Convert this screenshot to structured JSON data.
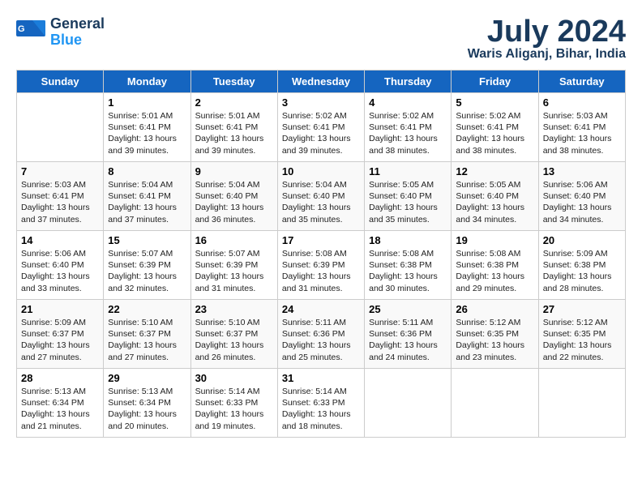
{
  "header": {
    "logo_line1": "General",
    "logo_line2": "Blue",
    "month": "July 2024",
    "location": "Waris Aliganj, Bihar, India"
  },
  "days_of_week": [
    "Sunday",
    "Monday",
    "Tuesday",
    "Wednesday",
    "Thursday",
    "Friday",
    "Saturday"
  ],
  "weeks": [
    [
      {
        "num": "",
        "info": ""
      },
      {
        "num": "1",
        "info": "Sunrise: 5:01 AM\nSunset: 6:41 PM\nDaylight: 13 hours\nand 39 minutes."
      },
      {
        "num": "2",
        "info": "Sunrise: 5:01 AM\nSunset: 6:41 PM\nDaylight: 13 hours\nand 39 minutes."
      },
      {
        "num": "3",
        "info": "Sunrise: 5:02 AM\nSunset: 6:41 PM\nDaylight: 13 hours\nand 39 minutes."
      },
      {
        "num": "4",
        "info": "Sunrise: 5:02 AM\nSunset: 6:41 PM\nDaylight: 13 hours\nand 38 minutes."
      },
      {
        "num": "5",
        "info": "Sunrise: 5:02 AM\nSunset: 6:41 PM\nDaylight: 13 hours\nand 38 minutes."
      },
      {
        "num": "6",
        "info": "Sunrise: 5:03 AM\nSunset: 6:41 PM\nDaylight: 13 hours\nand 38 minutes."
      }
    ],
    [
      {
        "num": "7",
        "info": "Sunrise: 5:03 AM\nSunset: 6:41 PM\nDaylight: 13 hours\nand 37 minutes."
      },
      {
        "num": "8",
        "info": "Sunrise: 5:04 AM\nSunset: 6:41 PM\nDaylight: 13 hours\nand 37 minutes."
      },
      {
        "num": "9",
        "info": "Sunrise: 5:04 AM\nSunset: 6:40 PM\nDaylight: 13 hours\nand 36 minutes."
      },
      {
        "num": "10",
        "info": "Sunrise: 5:04 AM\nSunset: 6:40 PM\nDaylight: 13 hours\nand 35 minutes."
      },
      {
        "num": "11",
        "info": "Sunrise: 5:05 AM\nSunset: 6:40 PM\nDaylight: 13 hours\nand 35 minutes."
      },
      {
        "num": "12",
        "info": "Sunrise: 5:05 AM\nSunset: 6:40 PM\nDaylight: 13 hours\nand 34 minutes."
      },
      {
        "num": "13",
        "info": "Sunrise: 5:06 AM\nSunset: 6:40 PM\nDaylight: 13 hours\nand 34 minutes."
      }
    ],
    [
      {
        "num": "14",
        "info": "Sunrise: 5:06 AM\nSunset: 6:40 PM\nDaylight: 13 hours\nand 33 minutes."
      },
      {
        "num": "15",
        "info": "Sunrise: 5:07 AM\nSunset: 6:39 PM\nDaylight: 13 hours\nand 32 minutes."
      },
      {
        "num": "16",
        "info": "Sunrise: 5:07 AM\nSunset: 6:39 PM\nDaylight: 13 hours\nand 31 minutes."
      },
      {
        "num": "17",
        "info": "Sunrise: 5:08 AM\nSunset: 6:39 PM\nDaylight: 13 hours\nand 31 minutes."
      },
      {
        "num": "18",
        "info": "Sunrise: 5:08 AM\nSunset: 6:38 PM\nDaylight: 13 hours\nand 30 minutes."
      },
      {
        "num": "19",
        "info": "Sunrise: 5:08 AM\nSunset: 6:38 PM\nDaylight: 13 hours\nand 29 minutes."
      },
      {
        "num": "20",
        "info": "Sunrise: 5:09 AM\nSunset: 6:38 PM\nDaylight: 13 hours\nand 28 minutes."
      }
    ],
    [
      {
        "num": "21",
        "info": "Sunrise: 5:09 AM\nSunset: 6:37 PM\nDaylight: 13 hours\nand 27 minutes."
      },
      {
        "num": "22",
        "info": "Sunrise: 5:10 AM\nSunset: 6:37 PM\nDaylight: 13 hours\nand 27 minutes."
      },
      {
        "num": "23",
        "info": "Sunrise: 5:10 AM\nSunset: 6:37 PM\nDaylight: 13 hours\nand 26 minutes."
      },
      {
        "num": "24",
        "info": "Sunrise: 5:11 AM\nSunset: 6:36 PM\nDaylight: 13 hours\nand 25 minutes."
      },
      {
        "num": "25",
        "info": "Sunrise: 5:11 AM\nSunset: 6:36 PM\nDaylight: 13 hours\nand 24 minutes."
      },
      {
        "num": "26",
        "info": "Sunrise: 5:12 AM\nSunset: 6:35 PM\nDaylight: 13 hours\nand 23 minutes."
      },
      {
        "num": "27",
        "info": "Sunrise: 5:12 AM\nSunset: 6:35 PM\nDaylight: 13 hours\nand 22 minutes."
      }
    ],
    [
      {
        "num": "28",
        "info": "Sunrise: 5:13 AM\nSunset: 6:34 PM\nDaylight: 13 hours\nand 21 minutes."
      },
      {
        "num": "29",
        "info": "Sunrise: 5:13 AM\nSunset: 6:34 PM\nDaylight: 13 hours\nand 20 minutes."
      },
      {
        "num": "30",
        "info": "Sunrise: 5:14 AM\nSunset: 6:33 PM\nDaylight: 13 hours\nand 19 minutes."
      },
      {
        "num": "31",
        "info": "Sunrise: 5:14 AM\nSunset: 6:33 PM\nDaylight: 13 hours\nand 18 minutes."
      },
      {
        "num": "",
        "info": ""
      },
      {
        "num": "",
        "info": ""
      },
      {
        "num": "",
        "info": ""
      }
    ]
  ]
}
